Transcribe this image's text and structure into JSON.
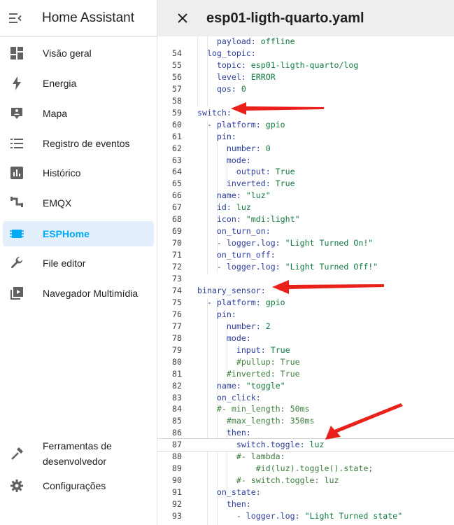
{
  "app": {
    "title": "Home Assistant"
  },
  "sidebar": {
    "items": [
      {
        "label": "Visão geral",
        "icon": "dashboard-icon"
      },
      {
        "label": "Energia",
        "icon": "lightning-icon"
      },
      {
        "label": "Mapa",
        "icon": "map-icon"
      },
      {
        "label": "Registro de eventos",
        "icon": "list-icon"
      },
      {
        "label": "Histórico",
        "icon": "chart-icon"
      },
      {
        "label": "EMQX",
        "icon": "pipe-icon"
      },
      {
        "label": "ESPHome",
        "icon": "chip-icon",
        "active": true
      },
      {
        "label": "File editor",
        "icon": "wrench-icon"
      },
      {
        "label": "Navegador Multimídia",
        "icon": "media-icon"
      }
    ],
    "bottom": [
      {
        "label": "Ferramentas de desenvolvedor",
        "icon": "hammer-icon"
      },
      {
        "label": "Configurações",
        "icon": "gear-icon"
      }
    ]
  },
  "editor": {
    "file_name": "esp01-ligth-quarto.yaml",
    "lines": [
      {
        "n": "",
        "text": "    payload: offline"
      },
      {
        "n": "54",
        "text": "  log_topic:"
      },
      {
        "n": "55",
        "text": "    topic: esp01-ligth-quarto/log"
      },
      {
        "n": "56",
        "text": "    level: ERROR"
      },
      {
        "n": "57",
        "text": "    qos: 0"
      },
      {
        "n": "58",
        "text": ""
      },
      {
        "n": "59",
        "text": "switch:"
      },
      {
        "n": "60",
        "text": "  - platform: gpio"
      },
      {
        "n": "61",
        "text": "    pin:"
      },
      {
        "n": "62",
        "text": "      number: 0"
      },
      {
        "n": "63",
        "text": "      mode:"
      },
      {
        "n": "64",
        "text": "        output: True"
      },
      {
        "n": "65",
        "text": "      inverted: True"
      },
      {
        "n": "66",
        "text": "    name: \"luz\""
      },
      {
        "n": "67",
        "text": "    id: luz"
      },
      {
        "n": "68",
        "text": "    icon: \"mdi:light\""
      },
      {
        "n": "69",
        "text": "    on_turn_on:"
      },
      {
        "n": "70",
        "text": "    - logger.log: \"Light Turned On!\""
      },
      {
        "n": "71",
        "text": "    on_turn_off:"
      },
      {
        "n": "72",
        "text": "    - logger.log: \"Light Turned Off!\""
      },
      {
        "n": "73",
        "text": ""
      },
      {
        "n": "74",
        "text": "binary_sensor:"
      },
      {
        "n": "75",
        "text": "  - platform: gpio"
      },
      {
        "n": "76",
        "text": "    pin:"
      },
      {
        "n": "77",
        "text": "      number: 2"
      },
      {
        "n": "78",
        "text": "      mode:"
      },
      {
        "n": "79",
        "text": "        input: True"
      },
      {
        "n": "80",
        "text": "        #pullup: True"
      },
      {
        "n": "81",
        "text": "      #inverted: True"
      },
      {
        "n": "82",
        "text": "    name: \"toggle\""
      },
      {
        "n": "83",
        "text": "    on_click:"
      },
      {
        "n": "84",
        "text": "    #- min_length: 50ms"
      },
      {
        "n": "85",
        "text": "      #max_length: 350ms"
      },
      {
        "n": "86",
        "text": "      then:"
      },
      {
        "n": "87",
        "text": "        switch.toggle: luz"
      },
      {
        "n": "88",
        "text": "        #- lambda:"
      },
      {
        "n": "89",
        "text": "            #id(luz).toggle().state;"
      },
      {
        "n": "90",
        "text": "        #- switch.toggle: luz"
      },
      {
        "n": "91",
        "text": "    on_state:"
      },
      {
        "n": "92",
        "text": "      then:"
      },
      {
        "n": "93",
        "text": "        - logger.log: \"Light Turned state\""
      }
    ],
    "active_line": "87"
  },
  "colors": {
    "accent": "#03a9f4",
    "annotation_arrow": "#e8211b",
    "active_nav_bg": "#e3f0fb"
  }
}
